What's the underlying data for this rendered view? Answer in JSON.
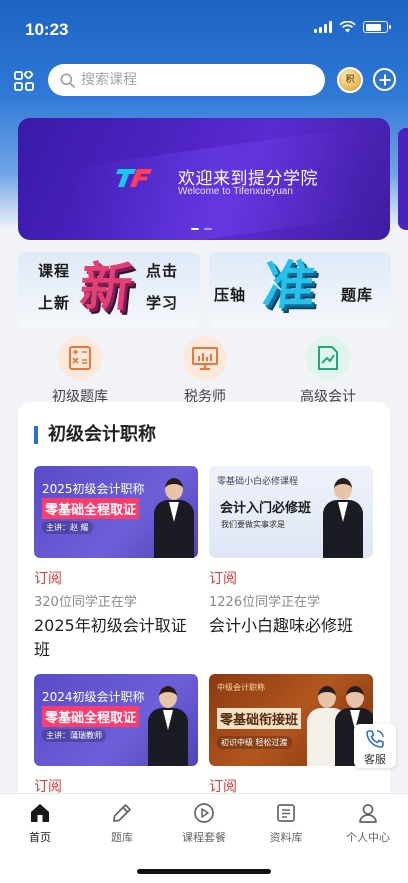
{
  "status": {
    "time": "10:23"
  },
  "search": {
    "placeholder": "搜索课程",
    "coin_label": "积"
  },
  "banner": {
    "title": "欢迎来到提分学院",
    "subtitle": "Welcome to Tifenxueyuan"
  },
  "promos": [
    {
      "tl": "课程",
      "tr": "点击",
      "bl": "上新",
      "br": "学习",
      "big": "新"
    },
    {
      "l": "压轴",
      "r": "题库",
      "big": "准"
    }
  ],
  "quick_links": [
    {
      "label": "初级题库",
      "icon": "calculator-icon"
    },
    {
      "label": "税务师",
      "icon": "presentation-chart-icon"
    },
    {
      "label": "高级会计",
      "icon": "document-chart-icon"
    }
  ],
  "section": {
    "title": "初级会计职称"
  },
  "courses": [
    {
      "thumb_line1": "2025初级会计职称",
      "thumb_line2": "零基础全程取证",
      "thumb_line3": "主讲：赵 耀",
      "tag": "订阅",
      "students": "320位同学正在学",
      "name": "2025年初级会计取证班"
    },
    {
      "thumb_line1": "零基础小白必修课程",
      "thumb_line2": "会计入门必修班",
      "thumb_line3": "我们要做实事求是",
      "tag": "订阅",
      "students": "1226位同学正在学",
      "name": "会计小白趣味必修班"
    },
    {
      "thumb_line1": "2024初级会计职称",
      "thumb_line2": "零基础全程取证",
      "thumb_line3": "主讲：蒲瑞教师",
      "tag": "订阅"
    },
    {
      "thumb_line1": "中级会计职称",
      "thumb_line2": "零基础衔接班",
      "thumb_line3": "初识中级  轻松过渡",
      "tag": "订阅"
    }
  ],
  "float_button": {
    "label": "客服"
  },
  "tabs": [
    {
      "label": "首页",
      "icon": "home-icon",
      "active": true
    },
    {
      "label": "题库",
      "icon": "pencil-icon"
    },
    {
      "label": "课程套餐",
      "icon": "play-circle-icon"
    },
    {
      "label": "资料库",
      "icon": "list-document-icon"
    },
    {
      "label": "个人中心",
      "icon": "person-icon"
    }
  ],
  "colors": {
    "primary": "#2a6fd8",
    "accent_red": "#e03a3a",
    "header_blue": "#1d63c4"
  }
}
